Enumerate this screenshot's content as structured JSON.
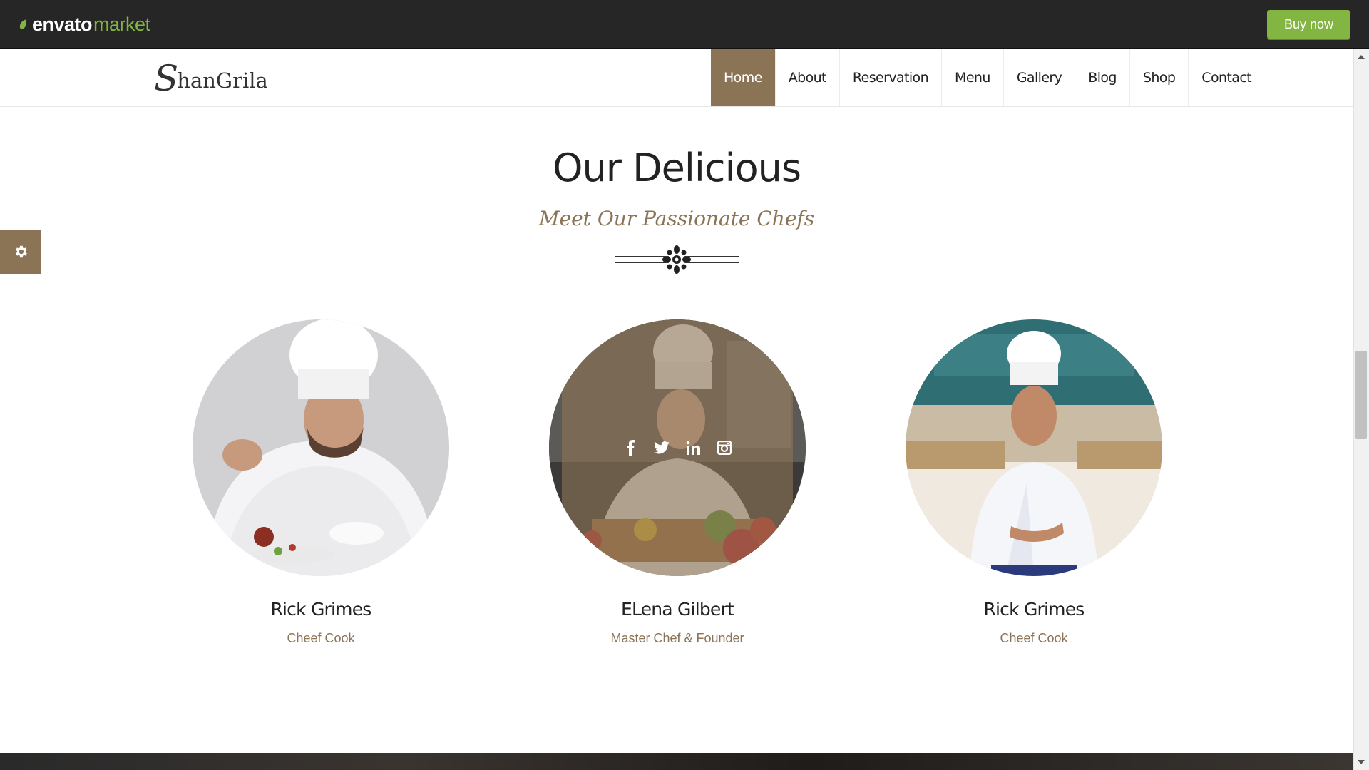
{
  "envato": {
    "logo_envato": "envato",
    "logo_market": "market",
    "buy_now_label": "Buy now",
    "accent": "#82b541"
  },
  "site": {
    "logo_initial": "S",
    "logo_rest": "hanGrila",
    "nav": [
      {
        "label": "Home",
        "active": true
      },
      {
        "label": "About"
      },
      {
        "label": "Reservation"
      },
      {
        "label": "Menu"
      },
      {
        "label": "Gallery"
      },
      {
        "label": "Blog"
      },
      {
        "label": "Shop"
      },
      {
        "label": "Contact"
      }
    ],
    "brand_color": "#8b7355"
  },
  "section": {
    "title": "Our Delicious",
    "subtitle": "Meet Our Passionate Chefs"
  },
  "chefs": [
    {
      "name": "Rick Grimes",
      "role": "Cheef Cook"
    },
    {
      "name": "ELena Gilbert",
      "role": "Master Chef & Founder",
      "social": [
        "facebook-icon",
        "twitter-icon",
        "linkedin-icon",
        "instagram-icon"
      ]
    },
    {
      "name": "Rick Grimes",
      "role": "Cheef Cook"
    }
  ],
  "icons": {
    "settings": "gear-icon"
  }
}
